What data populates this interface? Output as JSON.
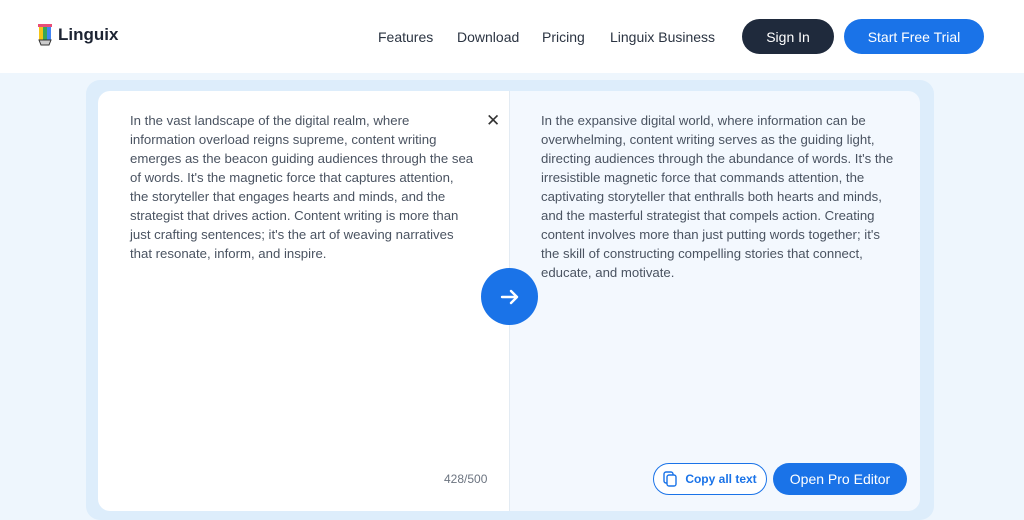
{
  "header": {
    "logo": "Linguix",
    "nav": [
      "Features",
      "Download",
      "Pricing",
      "Linguix Business"
    ],
    "sign_in": "Sign In",
    "trial": "Start Free Trial"
  },
  "editor": {
    "input": "In the vast landscape of the digital realm, where information overload reigns supreme, content writing emerges as the beacon guiding audiences through the sea of words. It's the magnetic force that captures attention, the storyteller that engages hearts and minds, and the strategist that drives action. Content writing is more than just crafting sentences; it's the art of weaving narratives that resonate, inform, and inspire.",
    "output": "In the expansive digital world, where information can be overwhelming, content writing serves as the guiding light, directing audiences through the abundance of words. It's the irresistible magnetic force that commands attention, the captivating storyteller that enthralls both hearts and minds, and the masterful strategist that compels action. Creating content involves more than just putting words together; it's the skill of constructing compelling stories that connect, educate, and motivate.",
    "char_count": "428/500",
    "copy_label": "Copy all text",
    "pro_label": "Open Pro Editor"
  },
  "colors": {
    "accent": "#1a73e8",
    "dark": "#1f2a3c"
  }
}
